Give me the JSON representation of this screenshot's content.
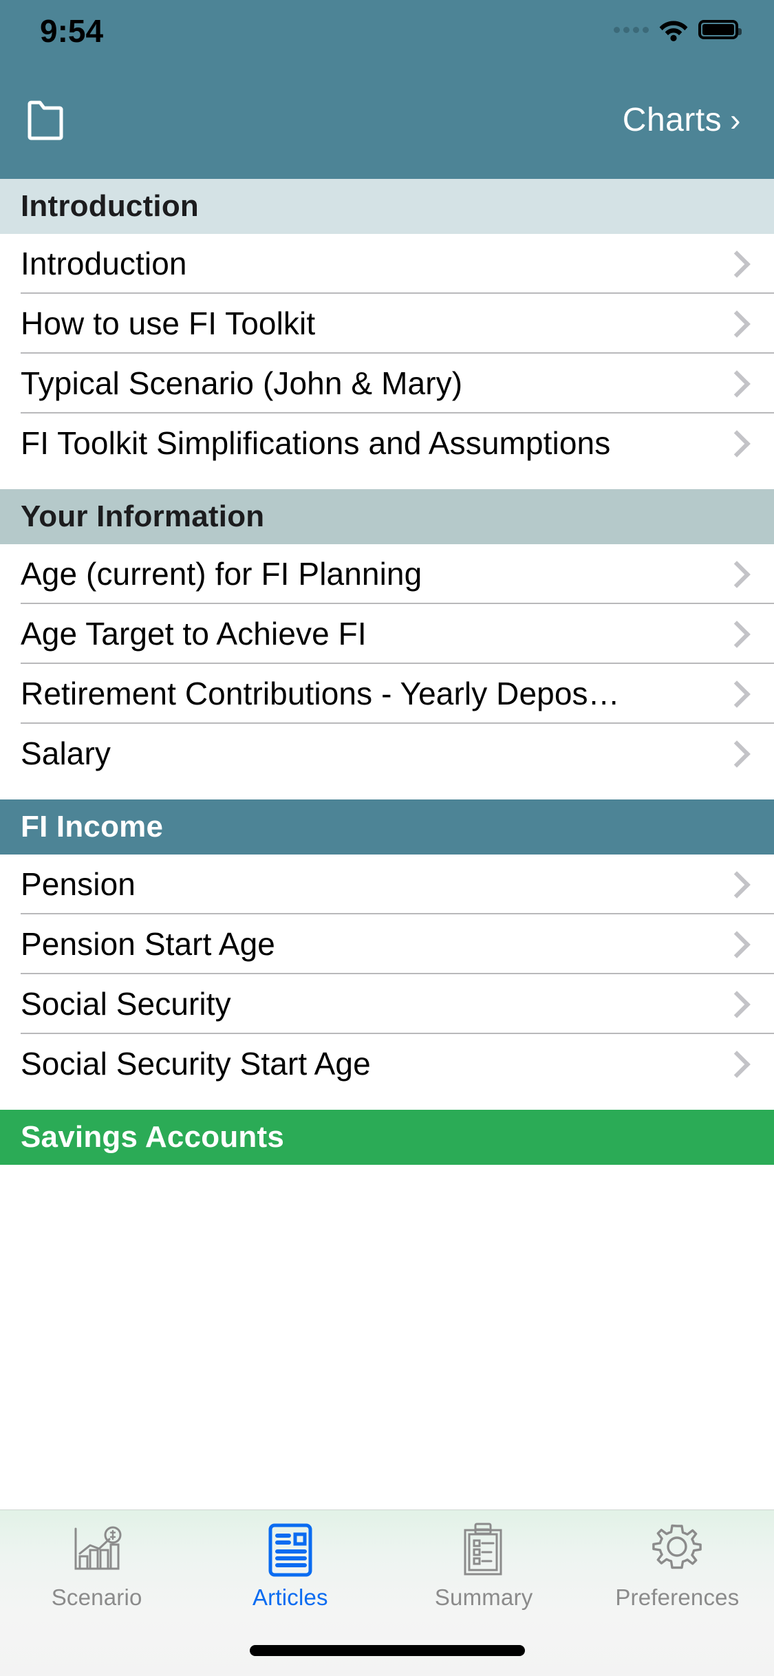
{
  "status_bar": {
    "time": "9:54",
    "icons": [
      "cellular-dots-icon",
      "wifi-icon",
      "battery-icon"
    ]
  },
  "nav_bar": {
    "left_icon": "folder-icon",
    "right_label": "Charts",
    "right_chevron": "›",
    "background_color": "#4d8496",
    "text_color": "#ffffff"
  },
  "list": {
    "sections": [
      {
        "title": "Introduction",
        "style": "intro",
        "background_color": "#d4e2e5",
        "text_color": "#1c1c1e",
        "rows": [
          {
            "label": "Introduction"
          },
          {
            "label": "How to use FI Toolkit"
          },
          {
            "label": "Typical Scenario (John & Mary)"
          },
          {
            "label": "FI Toolkit Simplifications and Assumptions"
          }
        ]
      },
      {
        "title": "Your Information",
        "style": "info",
        "background_color": "#b5c9ca",
        "text_color": "#1c1c1e",
        "rows": [
          {
            "label": "Age (current) for FI Planning"
          },
          {
            "label": "Age Target to Achieve FI"
          },
          {
            "label": "Retirement Contributions - Yearly Depos…"
          },
          {
            "label": "Salary"
          }
        ]
      },
      {
        "title": "FI Income",
        "style": "income",
        "background_color": "#4d8496",
        "text_color": "#ffffff",
        "rows": [
          {
            "label": "Pension"
          },
          {
            "label": "Pension Start Age"
          },
          {
            "label": "Social Security"
          },
          {
            "label": "Social Security Start Age"
          }
        ]
      },
      {
        "title": "Savings Accounts",
        "style": "savings",
        "background_color": "#2bab56",
        "text_color": "#ffffff",
        "rows": []
      }
    ],
    "row_accessory_icon": "chevron-right-icon"
  },
  "tab_bar": {
    "active_color": "#0a6cf1",
    "inactive_color": "#8b8b8b",
    "tabs": [
      {
        "label": "Scenario",
        "icon": "bar-chart-dollar-icon",
        "active": false
      },
      {
        "label": "Articles",
        "icon": "article-document-icon",
        "active": true
      },
      {
        "label": "Summary",
        "icon": "clipboard-list-icon",
        "active": false
      },
      {
        "label": "Preferences",
        "icon": "gear-icon",
        "active": false
      }
    ]
  },
  "home_indicator": {
    "visible": true
  }
}
